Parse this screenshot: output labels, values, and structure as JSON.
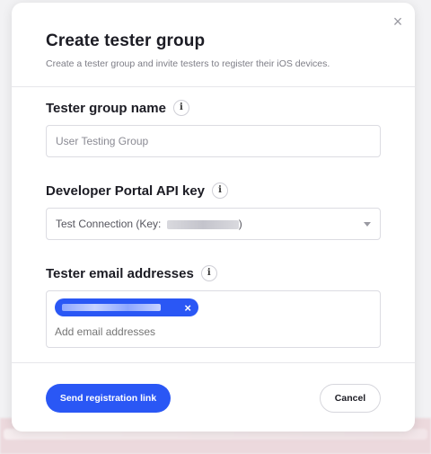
{
  "modal": {
    "title": "Create tester group",
    "subtitle": "Create a tester group and invite testers to register their iOS devices.",
    "close_icon": "×"
  },
  "fields": {
    "group_name": {
      "label": "Tester group name",
      "placeholder": "User Testing Group"
    },
    "api_key": {
      "label": "Developer Portal API key",
      "selected_value_prefix": "Test Connection (Key: ",
      "selected_value_suffix": ")"
    },
    "emails": {
      "label": "Tester email addresses",
      "placeholder": "Add email addresses",
      "chip_remove": "×"
    }
  },
  "info_glyph": "i",
  "buttons": {
    "send": "Send registration link",
    "cancel": "Cancel"
  },
  "colors": {
    "accent": "#2a57f5"
  }
}
